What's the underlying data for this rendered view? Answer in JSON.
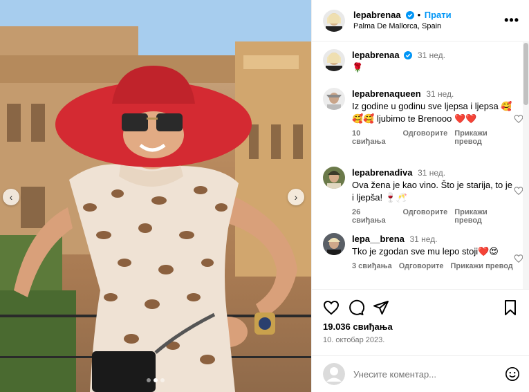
{
  "post": {
    "username": "lepabrenaa",
    "follow_label": "Прати",
    "location": "Palma De Mallorca, Spain",
    "more_label": "•••"
  },
  "caption": {
    "username": "lepabrenaa",
    "time": "31 нед.",
    "text": "🌹"
  },
  "comments": [
    {
      "username": "lepabrenaqueen",
      "time": "31 нед.",
      "text": "Iz godine u godinu sve ljepsa i ljepsa 🥰🥰🥰 ljubimo te Brenooo ❤️❤️",
      "likes": "10 свиђања",
      "reply": "Одговорите",
      "translate": "Прикажи превод"
    },
    {
      "username": "lepabrenadiva",
      "time": "31 нед.",
      "text": "Ova žena je kao vino. Što je starija, to je i ljepša! 🍷🥂",
      "likes": "26 свиђања",
      "reply": "Одговорите",
      "translate": "Прикажи превод"
    },
    {
      "username": "lepa__brena",
      "time": "31 нед.",
      "text": "Tko je zgodan sve mu lepo stoji❤️😍",
      "likes": "3 свиђања",
      "reply": "Одговорите",
      "translate": "Прикажи превод"
    }
  ],
  "stats": {
    "likes": "19.036 свиђања",
    "date": "10. октобар 2023."
  },
  "comment_input": {
    "placeholder": "Унесите коментар..."
  },
  "carousel": {
    "current_slide": 2,
    "total_slides": 3
  },
  "colors": {
    "accent": "#0095f6",
    "hat": "#d42a32",
    "text_muted": "#737373"
  },
  "icons": {
    "like": "heart-icon",
    "comment": "comment-icon",
    "share": "send-icon",
    "save": "bookmark-icon",
    "emoji": "emoji-icon",
    "verified": "verified-badge-icon",
    "prev": "chevron-left-icon",
    "next": "chevron-right-icon"
  }
}
